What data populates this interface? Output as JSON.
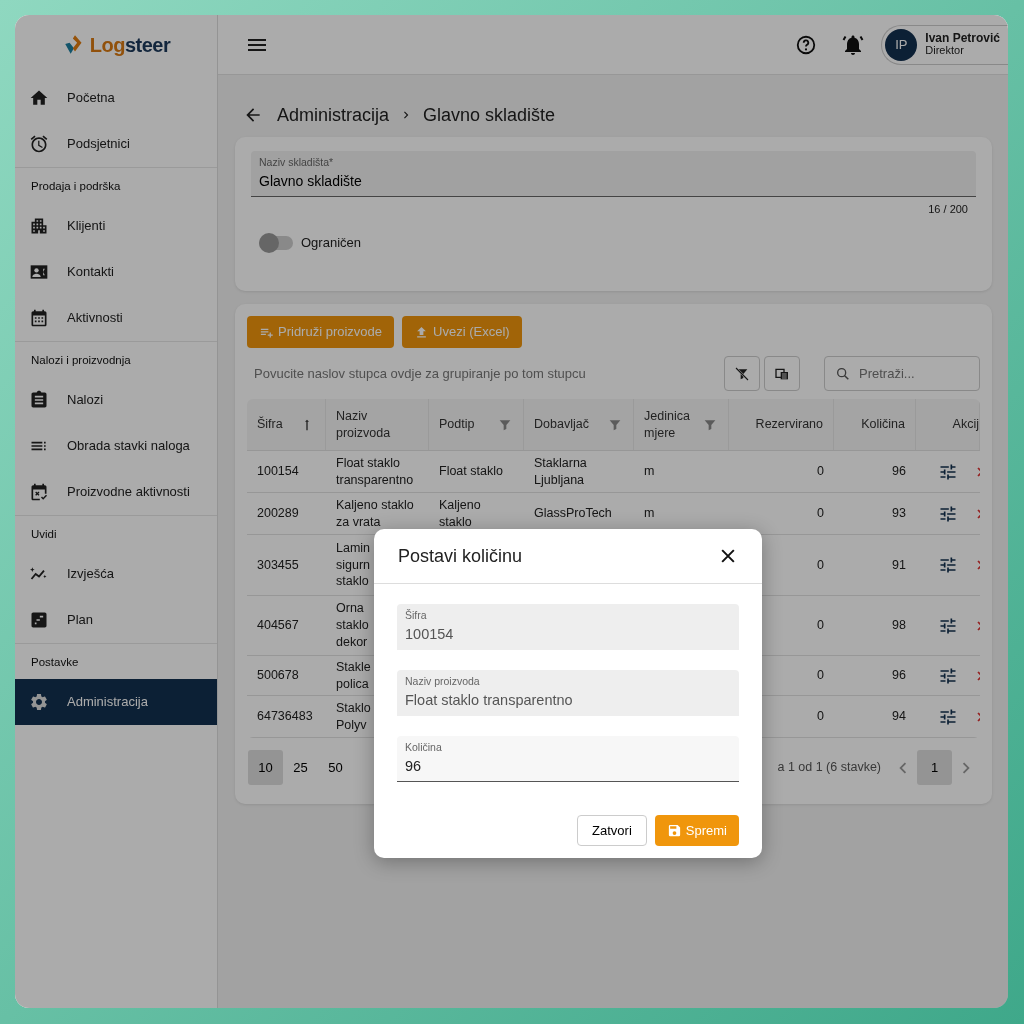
{
  "logo": {
    "part_1": "Log",
    "part_2": "steer"
  },
  "sidebar": {
    "items": [
      {
        "kind": "item",
        "label": "Početna",
        "selected": false
      },
      {
        "kind": "item",
        "label": "Podsjetnici",
        "selected": false
      },
      {
        "kind": "section",
        "label": "Prodaja i podrška"
      },
      {
        "kind": "item",
        "label": "Klijenti",
        "selected": false
      },
      {
        "kind": "item",
        "label": "Kontakti",
        "selected": false
      },
      {
        "kind": "item",
        "label": "Aktivnosti",
        "selected": false
      },
      {
        "kind": "section",
        "label": "Nalozi i proizvodnja"
      },
      {
        "kind": "item",
        "label": "Nalozi",
        "selected": false
      },
      {
        "kind": "item",
        "label": "Obrada stavki naloga",
        "selected": false
      },
      {
        "kind": "item",
        "label": "Proizvodne aktivnosti",
        "selected": false
      },
      {
        "kind": "section",
        "label": "Uvidi"
      },
      {
        "kind": "item",
        "label": "Izvješća",
        "selected": false
      },
      {
        "kind": "item",
        "label": "Plan",
        "selected": false
      },
      {
        "kind": "section",
        "label": "Postavke"
      },
      {
        "kind": "item",
        "label": "Administracija",
        "selected": true
      }
    ]
  },
  "user": {
    "initials": "IP",
    "name": "Ivan Petrović",
    "role": "Direktor"
  },
  "breadcrumb": [
    "Administracija",
    "Glavno skladište"
  ],
  "form": {
    "label": "Naziv skladišta*",
    "value": "Glavno skladište",
    "counter": "16 / 200",
    "toggle": {
      "label": "Ograničen",
      "on": false
    }
  },
  "toolbar": {
    "buttons": [
      "Pridruži proizvode",
      "Uvezi (Excel)"
    ],
    "group_hint": "Povucite naslov stupca ovdje za grupiranje po tom stupcu",
    "search_placeholder": "Pretraži..."
  },
  "table": {
    "columns": [
      {
        "label": "Šifra",
        "kind": "text",
        "sorted": true,
        "filterable": false
      },
      {
        "label": "Naziv\nproizvoda",
        "kind": "text",
        "sorted": false,
        "filterable": false
      },
      {
        "label": "Podtip",
        "kind": "text",
        "sorted": false,
        "filterable": true
      },
      {
        "label": "Dobavljač",
        "kind": "text",
        "sorted": false,
        "filterable": true
      },
      {
        "label": "Jedinica\nmjere",
        "kind": "text",
        "sorted": false,
        "filterable": true
      },
      {
        "label": "Rezervirano",
        "kind": "number",
        "sorted": false,
        "filterable": false
      },
      {
        "label": "Količina",
        "kind": "number",
        "sorted": false,
        "filterable": false
      },
      {
        "label": "Akcij",
        "kind": "actions",
        "sorted": false,
        "filterable": false
      }
    ],
    "rows": [
      [
        "100154",
        "Float staklo\ntransparentno",
        "Float staklo",
        "Staklarna\nLjubljana",
        "m",
        "0",
        "96"
      ],
      [
        "200289",
        "Kaljeno staklo\nza vrata",
        "Kaljeno\nstaklo",
        "GlassProTech",
        "m",
        "0",
        "93"
      ],
      [
        "303455",
        "Lamin\nsigurn\nstaklo",
        null,
        null,
        null,
        "0",
        "91"
      ],
      [
        "404567",
        "Orna\nstaklo\ndekor",
        null,
        null,
        null,
        "0",
        "98"
      ],
      [
        "500678",
        "Stakle\npolica",
        null,
        null,
        null,
        "0",
        "96"
      ],
      [
        "64736483",
        "Staklo\nPolyv",
        null,
        null,
        null,
        "0",
        "94"
      ]
    ]
  },
  "pagination": {
    "page_sizes": [
      {
        "label": "10",
        "selected": true
      },
      {
        "label": "25",
        "selected": false
      },
      {
        "label": "50",
        "selected": false
      }
    ],
    "info": "a 1 od 1 (6 stavke)",
    "pages": [
      {
        "label": "1",
        "selected": true
      }
    ]
  },
  "modal": {
    "title": "Postavi količinu",
    "fields": [
      {
        "label": "Šifra",
        "value": "100154",
        "disabled": true
      },
      {
        "label": "Naziv proizvoda",
        "value": "Float staklo transparentno",
        "disabled": true
      },
      {
        "label": "Količina",
        "value": "96",
        "disabled": false
      }
    ],
    "buttons": {
      "close": "Zatvori",
      "save": "Spremi"
    }
  }
}
